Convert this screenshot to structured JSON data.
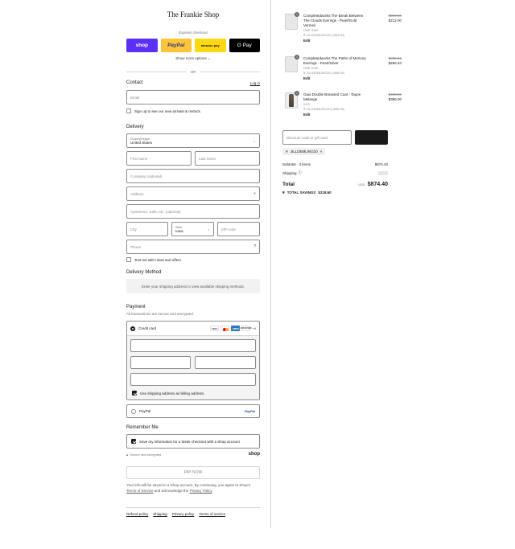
{
  "store": {
    "title": "The Frankie Shop"
  },
  "express": {
    "label": "Express checkout",
    "buttons": {
      "shop": "shop",
      "paypal": "PayPal",
      "amazon": "amazon pay",
      "gpay": "G Pay"
    },
    "more_options": "Show more options",
    "or": "OR"
  },
  "contact": {
    "heading": "Contact",
    "login": "Log in",
    "email_placeholder": "Email",
    "signup_label": "Sign up to see our new arrivals & restock."
  },
  "delivery": {
    "heading": "Delivery",
    "country_label": "Country/Region",
    "country_value": "United States",
    "first_name": "First name",
    "last_name": "Last name",
    "company": "Company (optional)",
    "address": "Address",
    "apartment": "Apartment, suite, etc. (optional)",
    "city": "City",
    "state_label": "State",
    "state_value": "Iowa",
    "zip": "ZIP code",
    "phone": "Phone",
    "text_me": "Text me with news and offers"
  },
  "delivery_method": {
    "heading": "Delivery Method",
    "info": "Enter your shipping address to view available shipping methods."
  },
  "payment": {
    "heading": "Payment",
    "note": "All transactions are secure and encrypted.",
    "credit_card": "Credit card",
    "cards": [
      "VISA",
      "",
      "AMEX",
      "DISCOVER"
    ],
    "more_cards": "+4",
    "billing_same": "Use shipping address as billing address",
    "paypal": "PayPal",
    "paypal_logo": "PayPal"
  },
  "remember": {
    "heading": "Remember Me",
    "save_label": "Save my information for a faster checkout with a Shop account",
    "secure": "Secure and encrypted",
    "shop_logo": "shop"
  },
  "pay_now": "PAY NOW",
  "terms": {
    "text_1": "Your info will be saved to a Shop account. By continuing, you agree to Shop's",
    "tos": "Terms of Service",
    "text_2": "and acknowledge the",
    "privacy": "Privacy Policy",
    "end": "."
  },
  "footer": {
    "links": [
      "Refund policy",
      "Shipping",
      "Privacy policy",
      "Terms of service"
    ]
  },
  "cart": {
    "items": [
      {
        "qty": "1",
        "name": "Completedworks The Break Between The Clouds Earrings - Pearl/Gold Vermeil",
        "variant": "ONE SIZE",
        "discount": "JILLDEMLING20 (-$53.00)",
        "original": "$265.00",
        "price": "$212.00",
        "edit": "Edit"
      },
      {
        "qty": "1",
        "name": "Completedworks The Paths of Memory Earrings - Pearl/Silver",
        "variant": "ONE SIZE",
        "discount": "JILLDEMLING20 (-$66.00)",
        "original": "$330.00",
        "price": "$266.40",
        "edit": "Edit"
      },
      {
        "qty": "1",
        "name": "Gaia Double Breasted Coat - Taupe Melange",
        "variant": "XXS",
        "discount": "JILLDEMLING20 (-$99.00)",
        "original": "$495.00",
        "price": "$396.00",
        "edit": "Edit"
      }
    ],
    "discount_placeholder": "Discount code or gift card",
    "code_chip": "JILLDEMLING20",
    "subtotal_label": "Subtotal · 3 items",
    "subtotal_value": "$874.40",
    "shipping_label": "Shipping",
    "total_label": "Total",
    "currency": "USD",
    "total_value": "$874.40",
    "savings_label": "TOTAL SAVINGS",
    "savings_value": "$218.60"
  }
}
